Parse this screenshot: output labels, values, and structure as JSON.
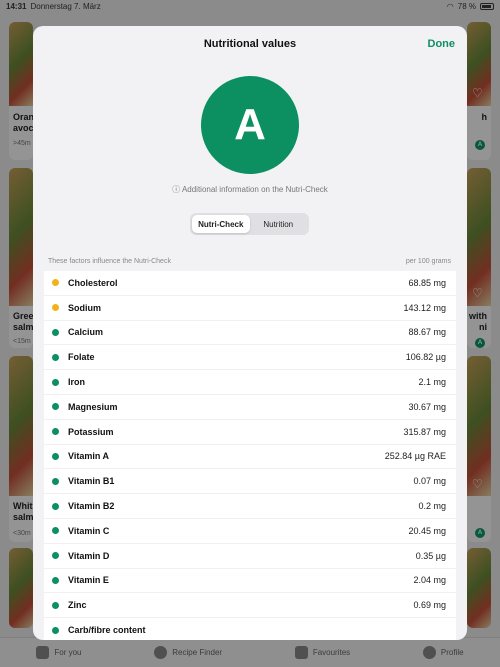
{
  "status_bar": {
    "time": "14:31",
    "date": "Donnerstag 7. März",
    "battery": "78 %"
  },
  "background": {
    "left_cards": [
      {
        "title": "Oran avoc",
        "meta": ">45m"
      },
      {
        "title": "Gree salm",
        "meta": "<15m"
      },
      {
        "title": "Whit salm",
        "meta": "<30m"
      }
    ],
    "right_cards": [
      {
        "title": "h",
        "meta": ""
      },
      {
        "title": "with ni",
        "meta": ""
      },
      {
        "title": "",
        "meta": ""
      }
    ],
    "badge_letter": "A"
  },
  "tab_bar": [
    {
      "label": "For you",
      "icon": "home-icon"
    },
    {
      "label": "Recipe Finder",
      "icon": "search-icon"
    },
    {
      "label": "Favourites",
      "icon": "heart-icon"
    },
    {
      "label": "Profile",
      "icon": "profile-icon"
    }
  ],
  "modal": {
    "title": "Nutritional values",
    "done_label": "Done",
    "grade": "A",
    "grade_color": "#0c8f61",
    "info_text": "ⓘ Additional information on the Nutri-Check",
    "segments": {
      "active": "Nutri-Check",
      "inactive": "Nutrition"
    },
    "factors_label": "These factors influence the Nutri-Check",
    "per_label": "per 100 grams",
    "colors": {
      "yellow": "#f2b21b",
      "green": "#0c8f61"
    },
    "items": [
      {
        "name": "Cholesterol",
        "value": "68.85 mg",
        "status": "yellow"
      },
      {
        "name": "Sodium",
        "value": "143.12 mg",
        "status": "yellow"
      },
      {
        "name": "Calcium",
        "value": "88.67 mg",
        "status": "green"
      },
      {
        "name": "Folate",
        "value": "106.82 µg",
        "status": "green"
      },
      {
        "name": "Iron",
        "value": "2.1 mg",
        "status": "green"
      },
      {
        "name": "Magnesium",
        "value": "30.67 mg",
        "status": "green"
      },
      {
        "name": "Potassium",
        "value": "315.87 mg",
        "status": "green"
      },
      {
        "name": "Vitamin A",
        "value": "252.84 µg RAE",
        "status": "green"
      },
      {
        "name": "Vitamin B1",
        "value": "0.07 mg",
        "status": "green"
      },
      {
        "name": "Vitamin B2",
        "value": "0.2 mg",
        "status": "green"
      },
      {
        "name": "Vitamin C",
        "value": "20.45 mg",
        "status": "green"
      },
      {
        "name": "Vitamin D",
        "value": "0.35 µg",
        "status": "green"
      },
      {
        "name": "Vitamin E",
        "value": "2.04 mg",
        "status": "green"
      },
      {
        "name": "Zinc",
        "value": "0.69 mg",
        "status": "green"
      },
      {
        "name": "Carb/fibre content",
        "value": "",
        "status": "green"
      }
    ]
  }
}
